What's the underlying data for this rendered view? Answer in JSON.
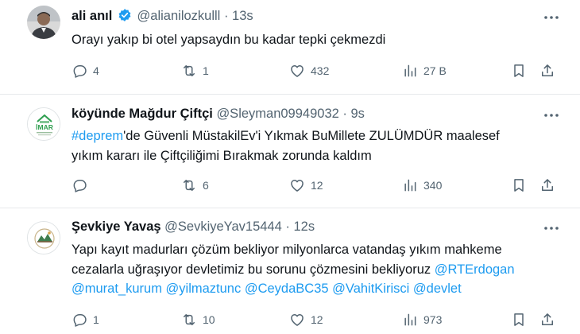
{
  "tweets": [
    {
      "name": "ali anıl",
      "handle": "@alianilozkulll",
      "time": "13s",
      "text": "Orayı yakıp bi otel yapsaydın bu kadar tepki çekmezdi",
      "replies": "4",
      "retweets": "1",
      "likes": "432",
      "views": "27 B",
      "verified": true
    },
    {
      "name": "köyünde Mağdur Çiftçi",
      "handle": "@Sleyman09949032",
      "time": "9s",
      "text_hashtag": "#deprem",
      "text_line1": "'de Güvenli MüstakilEv'i Yıkmak BuMillete ZULÜMDÜR maalesef",
      "text_line2": "yıkım kararı ile Çiftçiliğimi Bırakmak zorunda kaldım",
      "avatar_text": "İMAR",
      "replies": "",
      "retweets": "6",
      "likes": "12",
      "views": "340"
    },
    {
      "name": "Şevkiye Yavaş",
      "handle": "@SevkiyeYav15444",
      "time": "12s",
      "text_line1": "Yapı kayıt madurları çözüm bekliyor milyonlarca vatandaş yıkım mahkeme",
      "text_line2": "cezalarla uğraşıyor devletimiz bu sorunu çözmesini bekliyoruz ",
      "mention1": "@RTErdogan",
      "mention2": "@murat_kurum",
      "mention3": "@yilmaztunc",
      "mention4": "@CeydaBC35",
      "mention5": "@VahitKirisci",
      "mention6": "@devlet",
      "replies": "1",
      "retweets": "10",
      "likes": "12",
      "views": "973"
    }
  ],
  "separator": "·",
  "colors": {
    "link": "#1d9bf0",
    "muted": "#536471",
    "divider": "#e7e9ec",
    "verified": "#1d9bf0"
  }
}
